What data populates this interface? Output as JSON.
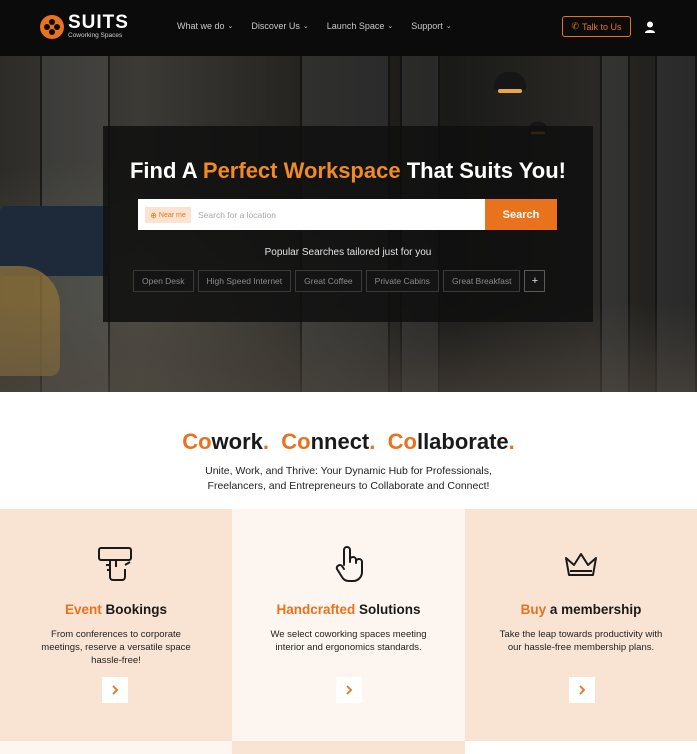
{
  "nav": {
    "logo": {
      "name": "SUITS",
      "sub": "Coworking Spaces"
    },
    "menu": [
      {
        "label": "What we do"
      },
      {
        "label": "Discover Us"
      },
      {
        "label": "Launch Space"
      },
      {
        "label": "Support"
      }
    ],
    "talk_label": "Talk to Us",
    "icons": {
      "chevron": "chevron-down-icon",
      "phone": "phone-icon",
      "user": "user-icon"
    }
  },
  "hero": {
    "title_before": "Find A ",
    "title_accent": "Perfect Workspace",
    "title_after": " That Suits You!",
    "near_me": "Near me",
    "search_placeholder": "Search for a location",
    "search_button": "Search",
    "popular_label": "Popular Searches tailored just for you",
    "chips": [
      "Open Desk",
      "High Speed Internet",
      "Great Coffee",
      "Private Cabins",
      "Great Breakfast"
    ],
    "more_chip": "+"
  },
  "tagline": {
    "words": [
      {
        "accent": "Co",
        "rest": "work",
        "dot": "."
      },
      {
        "accent": "Co",
        "rest": "nnect",
        "dot": "."
      },
      {
        "accent": "Co",
        "rest": "llaborate",
        "dot": "."
      }
    ],
    "sub": "Unite, Work, and Thrive: Your Dynamic Hub for Professionals, Freelancers, and Entrepreneurs to Collaborate and Connect!"
  },
  "cards": [
    {
      "accent": "Event",
      "rest": " Bookings",
      "desc": "From conferences to corporate meetings, reserve a versatile space hassle-free!",
      "icon": "hand-card-icon"
    },
    {
      "accent": "Handcrafted",
      "rest": " Solutions",
      "desc": "We select coworking spaces meeting interior and ergonomics standards.",
      "icon": "pointing-hand-icon"
    },
    {
      "accent": "Buy",
      "rest": " a membership",
      "desc": "Take the leap towards productivity with our hassle-free membership plans.",
      "icon": "crown-icon"
    }
  ],
  "colors": {
    "accent": "#e8731c",
    "nav_bg": "#0b0b0b",
    "card_peach": "#f9e4d4",
    "card_light": "#fdf5ef"
  }
}
